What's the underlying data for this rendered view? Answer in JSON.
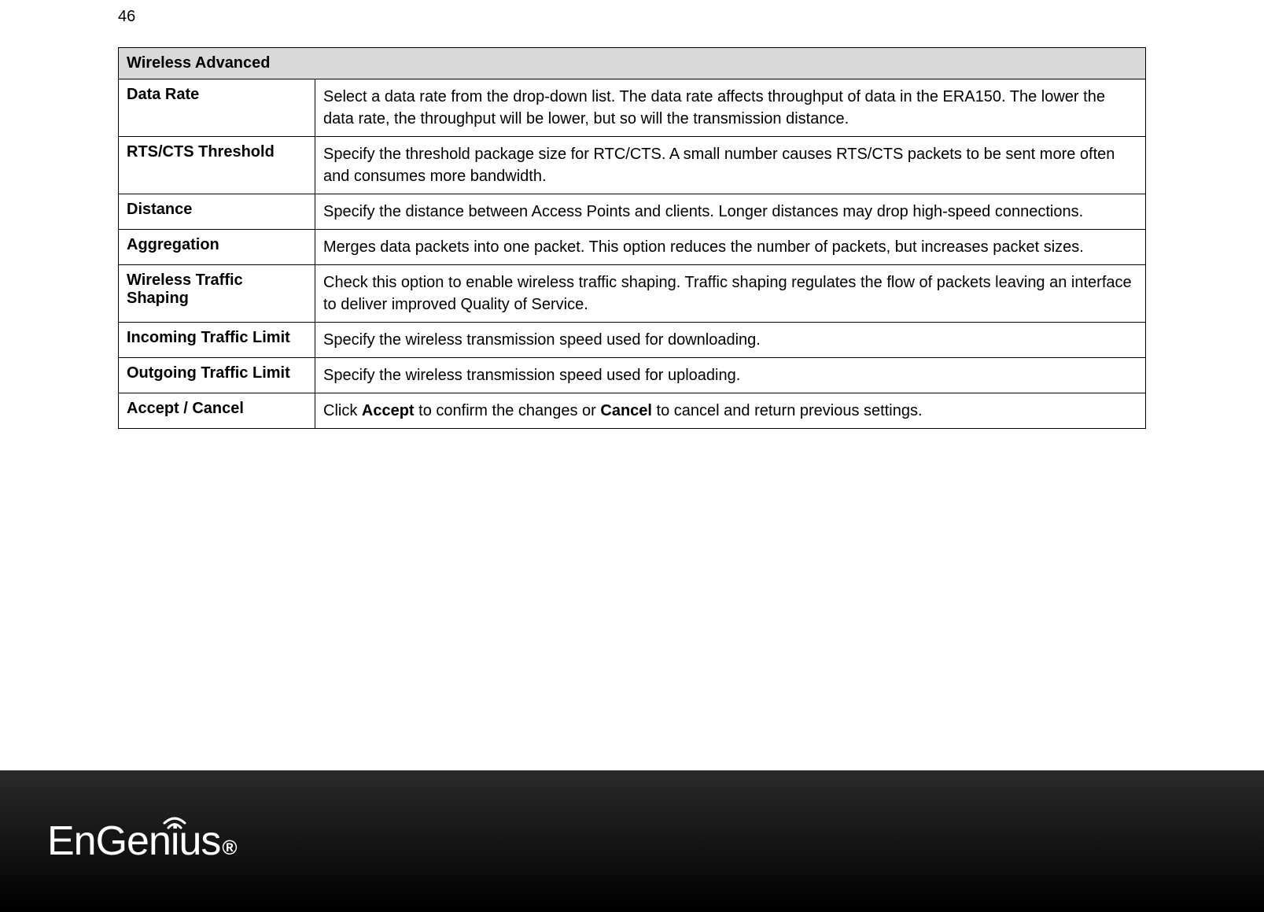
{
  "page_number": "46",
  "table": {
    "header": "Wireless Advanced",
    "rows": [
      {
        "label": "Data Rate",
        "desc": "Select a data rate from the drop-down list. The data rate affects throughput of data in the ERA150. The lower the data rate, the throughput will be lower, but so will the transmission distance."
      },
      {
        "label": "RTS/CTS Threshold",
        "desc": "Specify the threshold package size for RTC/CTS. A small number causes RTS/CTS packets to be sent more often and consumes more bandwidth."
      },
      {
        "label": "Distance",
        "desc": "Specify the distance between Access Points and clients. Longer distances may drop high-speed connections."
      },
      {
        "label": "Aggregation",
        "desc": "Merges data packets into one packet. This option reduces the number of packets, but increases packet sizes."
      },
      {
        "label": "Wireless Traffic Shaping",
        "desc": "Check this option to enable wireless traffic shaping. Traffic shaping regulates the flow of packets leaving an interface to deliver improved Quality of Service."
      },
      {
        "label": "Incoming Traffic Limit",
        "desc": "Specify the wireless transmission speed used for downloading."
      },
      {
        "label": "Outgoing Traffic Limit",
        "desc": "Specify the wireless transmission speed used for uploading."
      },
      {
        "label": "Accept / Cancel",
        "desc_prefix": "Click ",
        "desc_bold1": "Accept",
        "desc_mid": " to confirm the changes or ",
        "desc_bold2": "Cancel",
        "desc_suffix": " to cancel and return previous settings."
      }
    ]
  },
  "logo": {
    "text_en": "En",
    "text_gen": "Gen",
    "text_i": "i",
    "text_us": "us",
    "reg": "®"
  }
}
